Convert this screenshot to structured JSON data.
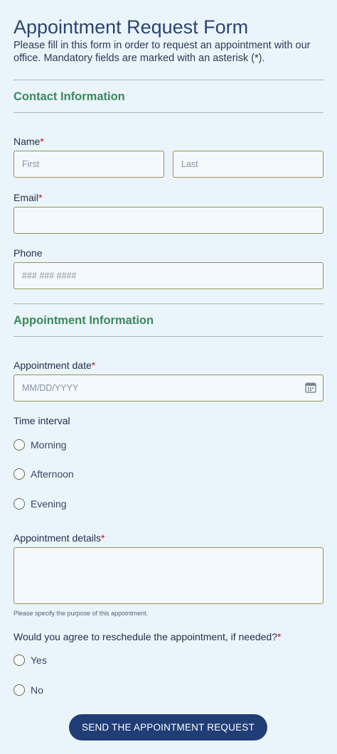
{
  "form": {
    "title": "Appointment Request Form",
    "description": "Please fill in this form in order to request an appointment with our office. Mandatory fields are marked with an asterisk (*)."
  },
  "contact_section": {
    "heading": "Contact Information",
    "name_label": "Name",
    "first_placeholder": "First",
    "last_placeholder": "Last",
    "email_label": "Email",
    "email_value": "",
    "phone_label": "Phone",
    "phone_placeholder": "### ### ####"
  },
  "appointment_section": {
    "heading": "Appointment Information",
    "date_label": "Appointment date",
    "date_placeholder": "MM/DD/YYYY",
    "time_label": "Time interval",
    "time_options": [
      "Morning",
      "Afternoon",
      "Evening"
    ],
    "details_label": "Appointment details",
    "details_value": "",
    "details_hint": "Please specify the purpose of this appointment.",
    "reschedule_label": "Would you agree to reschedule the appointment, if needed?",
    "reschedule_options": [
      "Yes",
      "No"
    ]
  },
  "required_mark": "*",
  "submit_label": "SEND THE APPOINTMENT REQUEST",
  "colors": {
    "background": "#eaf4fb",
    "title": "#2b4470",
    "section_heading": "#3a8a5a",
    "field_border": "#9a8f55",
    "required": "#d0021b",
    "button": "#213d76"
  }
}
